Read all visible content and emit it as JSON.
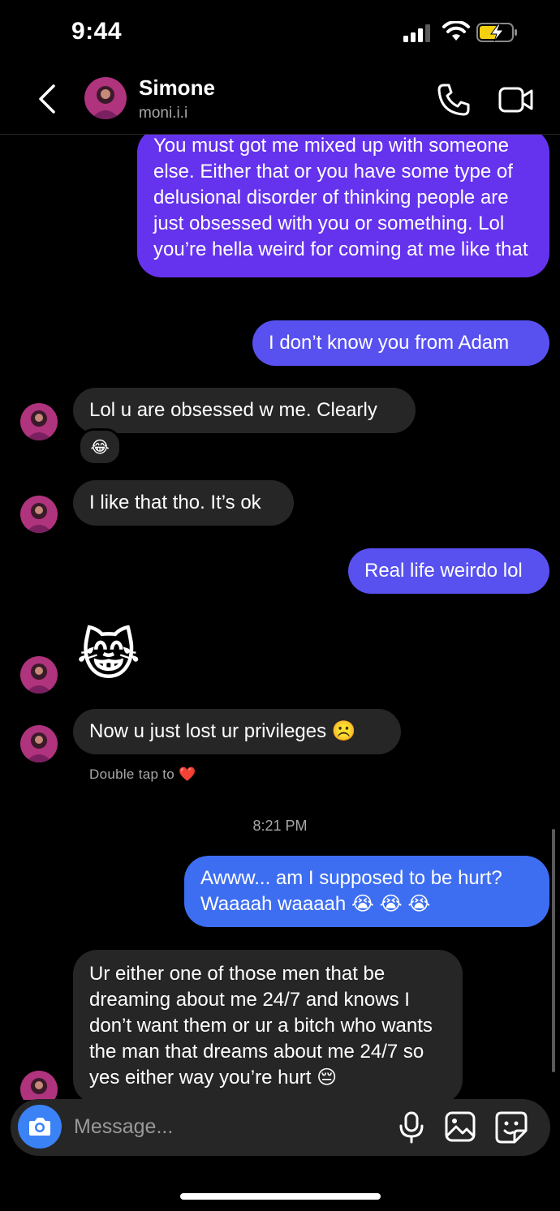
{
  "status_bar": {
    "time": "9:44"
  },
  "header": {
    "name": "Simone",
    "handle": "moni.i.i"
  },
  "messages": [
    {
      "from": "me",
      "text": "You must got me mixed up with someone else. Either that or you have some type of delusional disorder of thinking people are just obsessed with you or something. Lol you’re hella weird for coming at me like that"
    },
    {
      "from": "me",
      "text": "I don’t know you from Adam"
    },
    {
      "from": "them",
      "text": "Lol u are obsessed w me. Clearly",
      "reaction": "😂"
    },
    {
      "from": "them",
      "text": "I like that tho. It’s ok"
    },
    {
      "from": "me",
      "text": "Real life weirdo lol"
    },
    {
      "from": "them",
      "text": "😹"
    },
    {
      "from": "them",
      "text": "Now u just lost ur privileges ☹️",
      "hint": "Double tap to ❤️"
    },
    {
      "from": "me",
      "text": "Awww... am I supposed to be hurt? Waaaah waaaah 😭 😭 😭"
    },
    {
      "from": "them",
      "text": "Ur either one of those men that be dreaming about me 24/7 and knows I don’t want them or ur a bitch who wants the man that dreams about me 24/7 so yes either way you’re hurt 😔"
    }
  ],
  "timestamp": "8:21 PM",
  "composer": {
    "placeholder": "Message..."
  },
  "colors": {
    "sent_purple": "#6533ee",
    "sent_indigo": "#5851f0",
    "sent_blue": "#3d6ef2",
    "received": "#262626",
    "camera_button": "#3b82f6"
  }
}
